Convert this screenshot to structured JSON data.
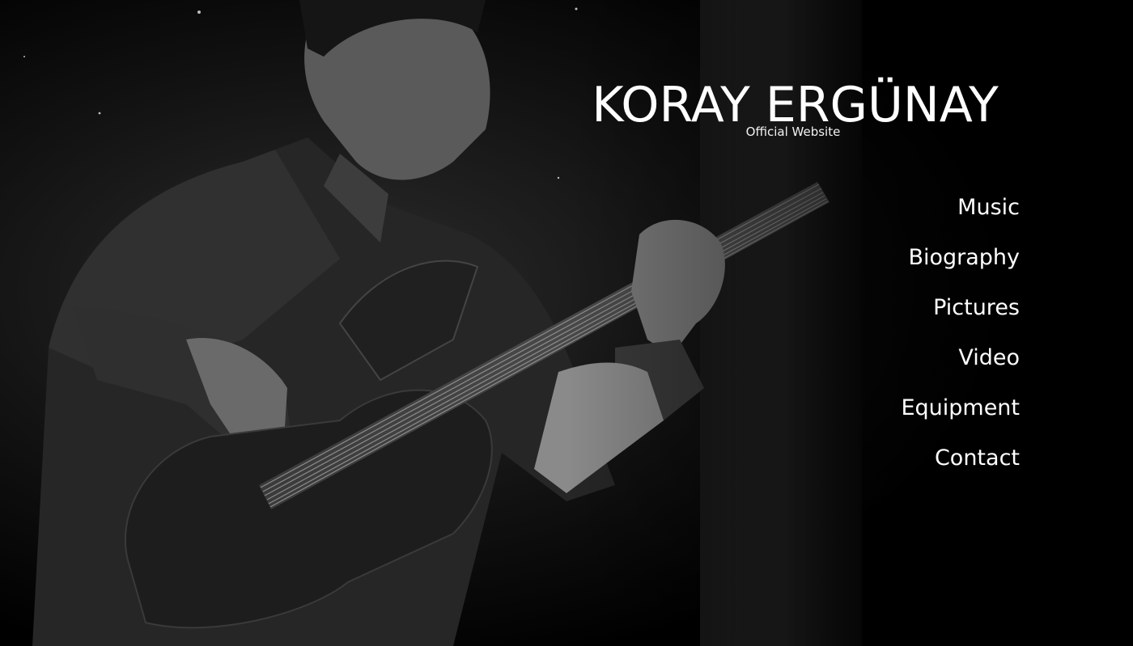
{
  "site": {
    "title": "KORAY ERGÜNAY",
    "subtitle": "Official Website"
  },
  "nav": {
    "items": [
      {
        "label": "Music"
      },
      {
        "label": "Biography"
      },
      {
        "label": "Pictures"
      },
      {
        "label": "Video"
      },
      {
        "label": "Equipment"
      },
      {
        "label": "Contact"
      }
    ]
  },
  "colors": {
    "background": "#000000",
    "text": "#ffffff"
  }
}
